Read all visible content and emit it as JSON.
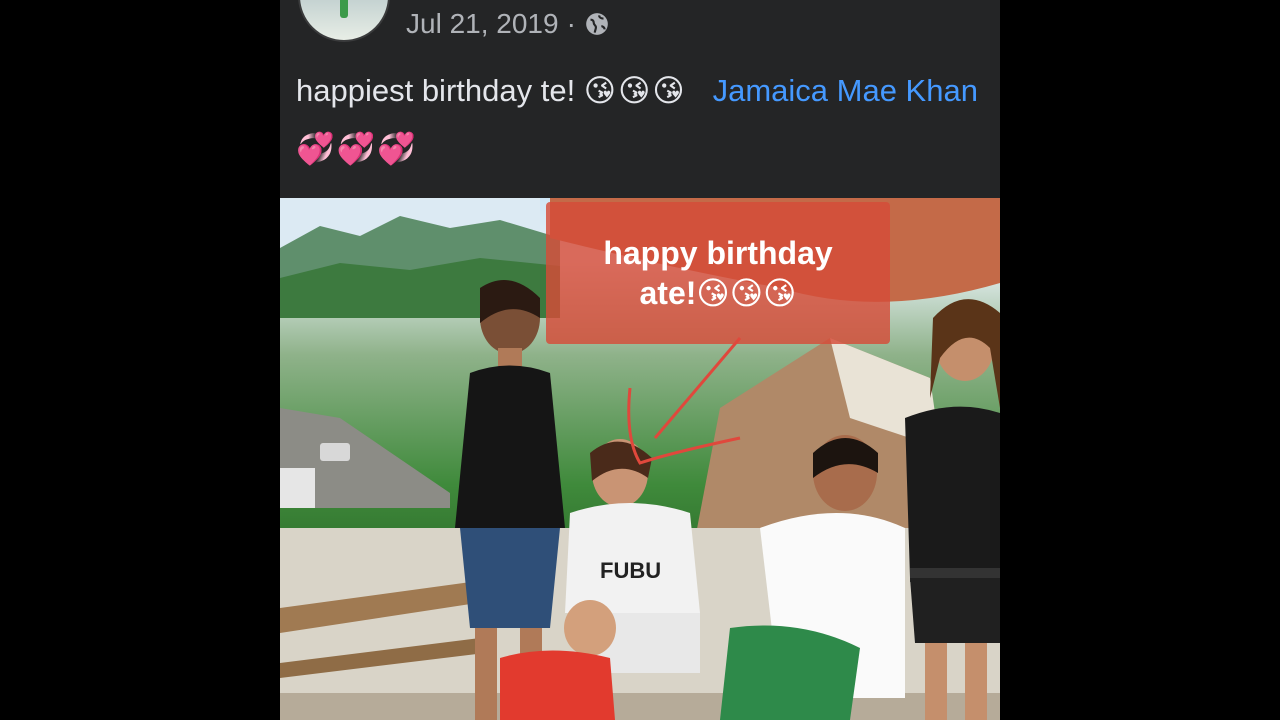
{
  "post": {
    "date": "Jul 21, 2019",
    "separator": "·",
    "privacy_icon": "globe-icon",
    "caption_text": "happiest birthday te! ",
    "caption_emojis": "😘😘😘",
    "mention": "Jamaica Mae Khan",
    "trailing_emojis": "💞💞💞"
  },
  "photo": {
    "sticker_line1": "happy birthday",
    "sticker_line2": "ate!😘😘😘"
  },
  "colors": {
    "background": "#000000",
    "card": "#242526",
    "text": "#e4e6eb",
    "meta": "#b0b3b8",
    "mention": "#4599ff",
    "sticker": "#d64c38"
  }
}
